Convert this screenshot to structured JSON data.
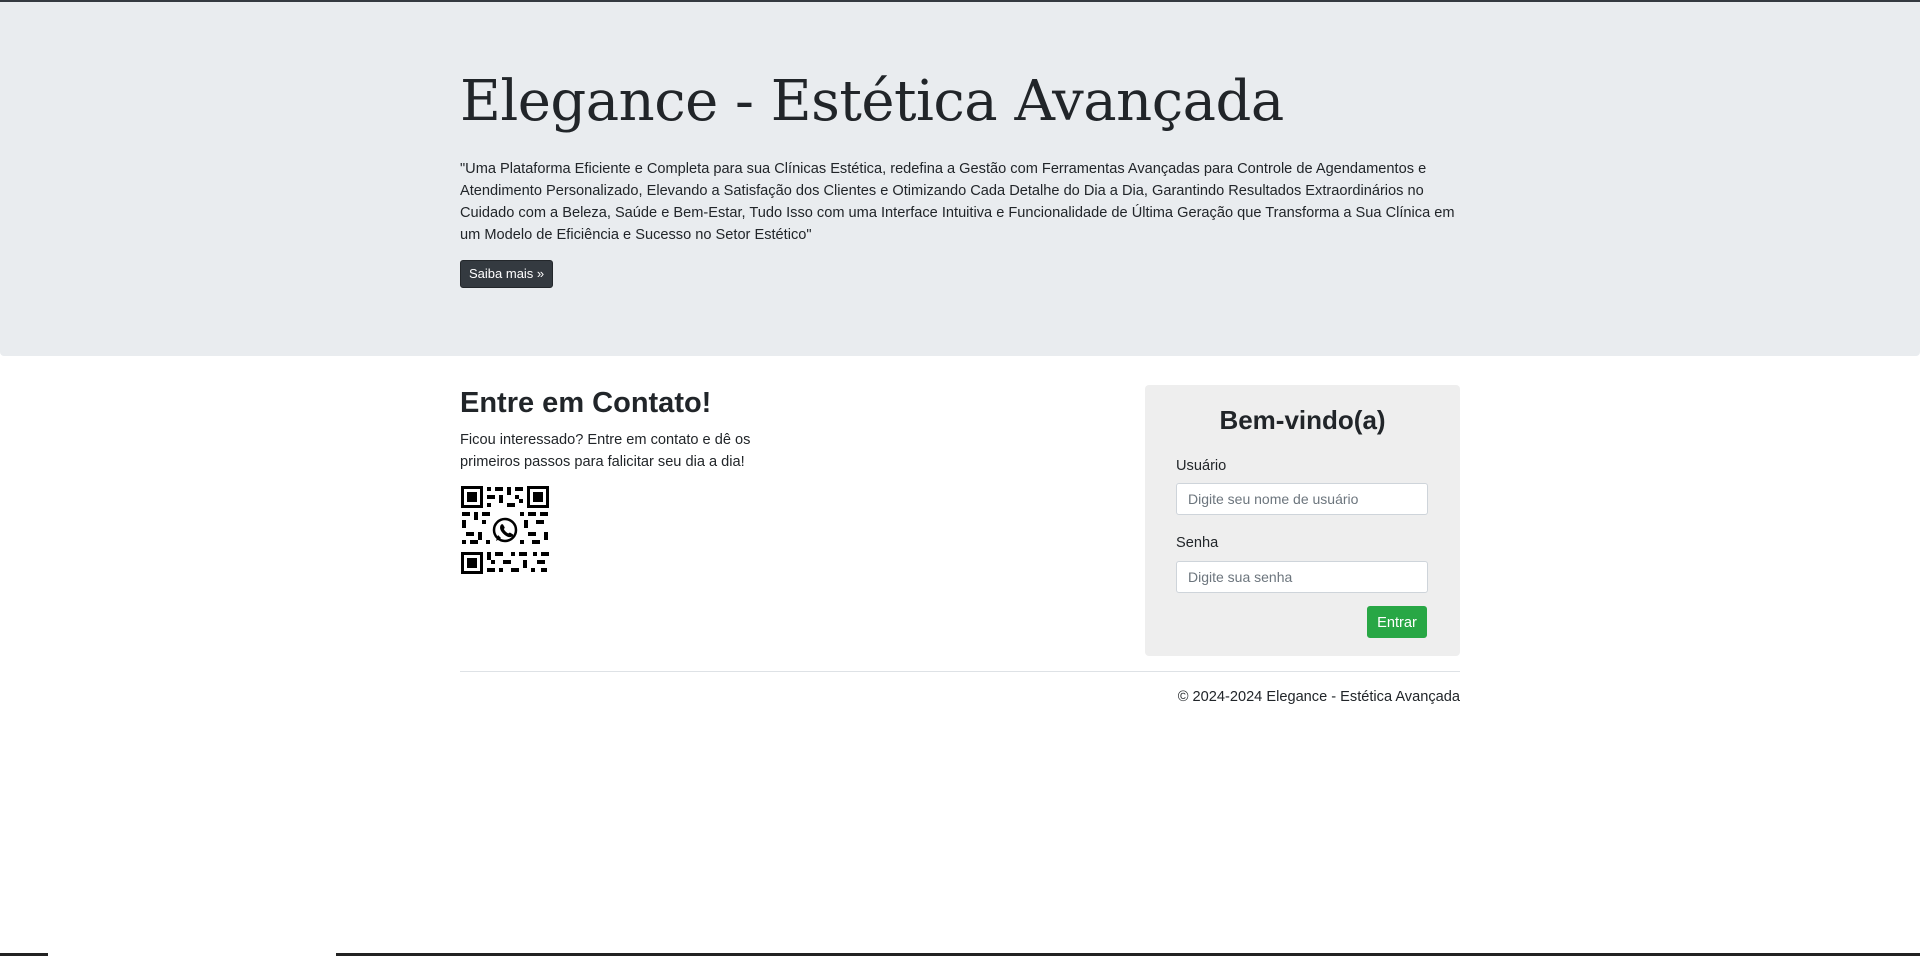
{
  "hero": {
    "title": "Elegance - Estética Avançada",
    "text": "\"Uma Plataforma Eficiente e Completa para sua Clínicas Estética, redefina a Gestão com Ferramentas Avançadas para Controle de Agendamentos e Atendimento Personalizado, Elevando a Satisfação dos Clientes e Otimizando Cada Detalhe do Dia a Dia, Garantindo Resultados Extraordinários no Cuidado com a Beleza, Saúde e Bem-Estar, Tudo Isso com uma Interface Intuitiva e Funcionalidade de Última Geração que Transforma a Sua Clínica em um Modelo de Eficiência e Sucesso no Setor Estético\"",
    "button_label": "Saiba mais »"
  },
  "contact": {
    "title": "Entre em Contato!",
    "text": "Ficou interessado? Entre em contato e dê os primeiros passos para falicitar seu dia a dia!",
    "qr_icon": "whatsapp-qr-code-icon"
  },
  "login": {
    "title": "Bem-vindo(a)",
    "username_label": "Usuário",
    "username_placeholder": "Digite seu nome de usuário",
    "password_label": "Senha",
    "password_placeholder": "Digite sua senha",
    "submit_label": "Entrar"
  },
  "footer": {
    "text": "© 2024-2024 Elegance - Estética Avançada"
  },
  "colors": {
    "hero_bg": "#e9ecef",
    "dark_button": "#343a40",
    "success_button": "#28a745",
    "login_panel_bg": "#eeeeee"
  }
}
